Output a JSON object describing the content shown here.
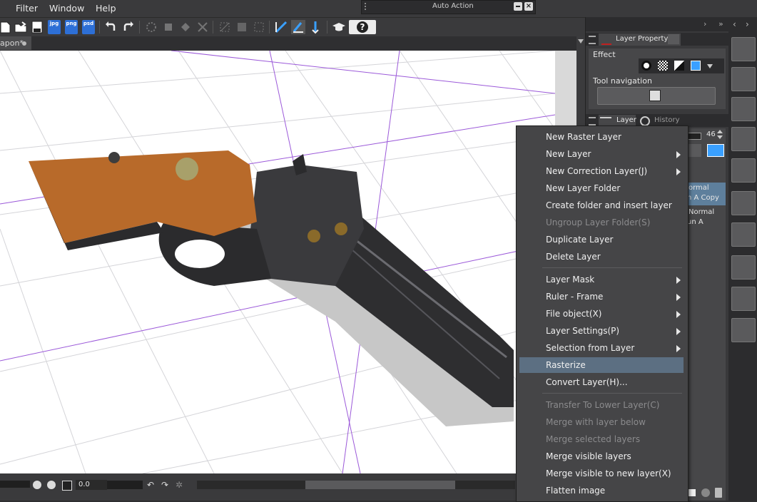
{
  "menubar": {
    "items": [
      "Filter",
      "Window",
      "Help"
    ]
  },
  "auto_action": {
    "title": "Auto Action"
  },
  "document": {
    "tab_label": "apon*"
  },
  "toolbar": {
    "file_icons": [
      "jpg",
      "png",
      "psd"
    ]
  },
  "layer_property": {
    "tab_label": "Layer Property",
    "effect_label": "Effect",
    "tool_navigation_label": "Tool navigation"
  },
  "layer_panel": {
    "tabs": [
      "Layer",
      "History"
    ],
    "opacity_value": "46",
    "rows": [
      {
        "mode": "ormal",
        "name": "n A Copy"
      },
      {
        "mode": "Normal",
        "name": "un A"
      }
    ]
  },
  "bottombar": {
    "zoom_value": "0.0"
  },
  "context_menu": {
    "groups": [
      [
        {
          "label": "New Raster Layer",
          "submenu": false,
          "disabled": false
        },
        {
          "label": "New Layer",
          "submenu": true,
          "disabled": false
        },
        {
          "label": "New Correction Layer(J)",
          "submenu": true,
          "disabled": false
        },
        {
          "label": "New Layer Folder",
          "submenu": false,
          "disabled": false
        },
        {
          "label": "Create folder and insert layer",
          "submenu": false,
          "disabled": false
        },
        {
          "label": "Ungroup Layer Folder(S)",
          "submenu": false,
          "disabled": true
        },
        {
          "label": "Duplicate Layer",
          "submenu": false,
          "disabled": false
        },
        {
          "label": "Delete Layer",
          "submenu": false,
          "disabled": false
        }
      ],
      [
        {
          "label": "Layer Mask",
          "submenu": true,
          "disabled": false
        },
        {
          "label": "Ruler - Frame",
          "submenu": true,
          "disabled": false
        },
        {
          "label": "File object(X)",
          "submenu": true,
          "disabled": false
        },
        {
          "label": "Layer Settings(P)",
          "submenu": true,
          "disabled": false
        },
        {
          "label": "Selection from Layer",
          "submenu": true,
          "disabled": false
        },
        {
          "label": "Rasterize",
          "submenu": false,
          "disabled": false,
          "highlighted": true
        },
        {
          "label": "Convert Layer(H)...",
          "submenu": false,
          "disabled": false
        }
      ],
      [
        {
          "label": "Transfer To Lower Layer(C)",
          "submenu": false,
          "disabled": true
        },
        {
          "label": "Merge with layer below",
          "submenu": false,
          "disabled": true
        },
        {
          "label": "Merge selected layers",
          "submenu": false,
          "disabled": true
        },
        {
          "label": "Merge visible layers",
          "submenu": false,
          "disabled": false
        },
        {
          "label": "Merge visible to new layer(X)",
          "submenu": false,
          "disabled": false
        },
        {
          "label": "Flatten image",
          "submenu": false,
          "disabled": false
        }
      ]
    ]
  },
  "colors": {
    "highlight": "#5c6f82",
    "menu_bg": "#454547",
    "accent_blue": "#2d6fd6"
  }
}
